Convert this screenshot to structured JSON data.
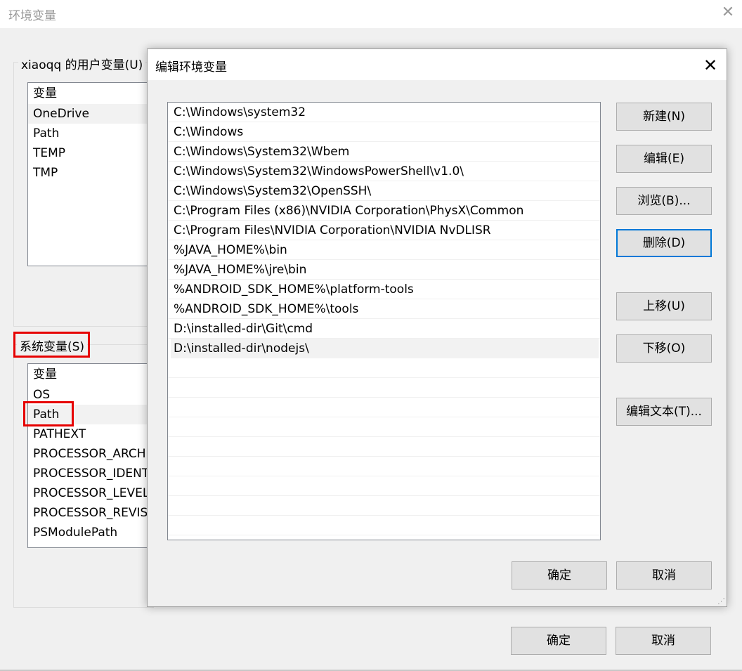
{
  "outer_window": {
    "title": "环境变量",
    "close_glyph": "✕",
    "user_group_label": "xiaoqq 的用户变量(U)",
    "user_vars": {
      "header": "变量",
      "items": [
        "OneDrive",
        "Path",
        "TEMP",
        "TMP"
      ]
    },
    "system_group_label": "系统变量(S)",
    "system_vars": {
      "header": "变量",
      "items": [
        "OS",
        "Path",
        "PATHEXT",
        "PROCESSOR_ARCH",
        "PROCESSOR_IDENT",
        "PROCESSOR_LEVEL",
        "PROCESSOR_REVIS",
        "PSModulePath"
      ]
    },
    "ok_label": "确定",
    "cancel_label": "取消"
  },
  "dialog": {
    "title": "编辑环境变量",
    "close_glyph": "✕",
    "paths": [
      "C:\\Windows\\system32",
      "C:\\Windows",
      "C:\\Windows\\System32\\Wbem",
      "C:\\Windows\\System32\\WindowsPowerShell\\v1.0\\",
      "C:\\Windows\\System32\\OpenSSH\\",
      "C:\\Program Files (x86)\\NVIDIA Corporation\\PhysX\\Common",
      "C:\\Program Files\\NVIDIA Corporation\\NVIDIA NvDLISR",
      "%JAVA_HOME%\\bin",
      "%JAVA_HOME%\\jre\\bin",
      "%ANDROID_SDK_HOME%\\platform-tools",
      "%ANDROID_SDK_HOME%\\tools",
      "D:\\installed-dir\\Git\\cmd",
      "D:\\installed-dir\\nodejs\\"
    ],
    "selected_index": 12,
    "buttons": {
      "new": "新建(N)",
      "edit": "编辑(E)",
      "browse": "浏览(B)...",
      "delete": "删除(D)",
      "move_up": "上移(U)",
      "move_down": "下移(O)",
      "edit_text": "编辑文本(T)..."
    },
    "ok_label": "确定",
    "cancel_label": "取消"
  },
  "colors": {
    "highlight_red": "#e60000",
    "focus_blue": "#0078d7",
    "selected_row": "#f2f2f2"
  }
}
